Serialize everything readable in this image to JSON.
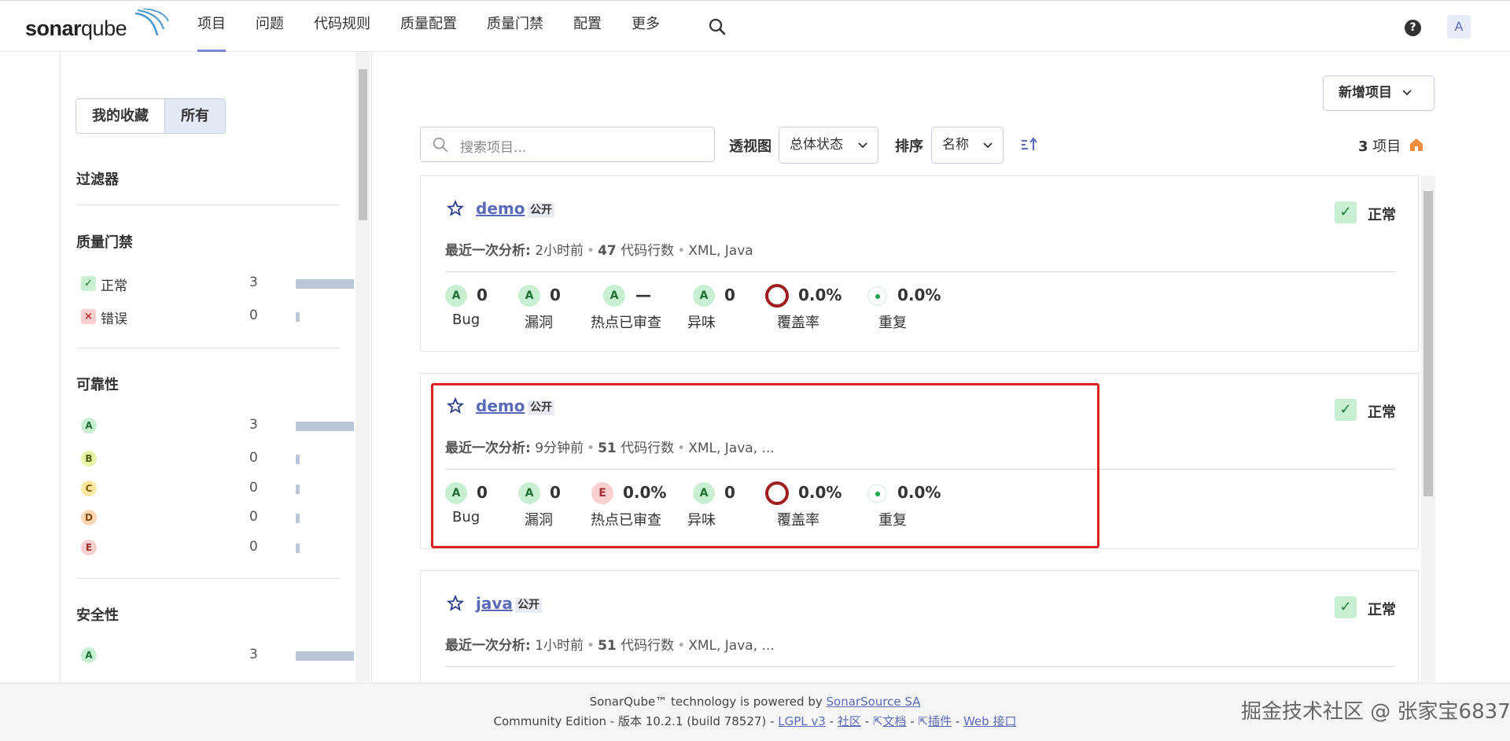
{
  "nav": {
    "logo_text": "sonarqube",
    "items": [
      {
        "label": "项目"
      },
      {
        "label": "问题"
      },
      {
        "label": "代码规则"
      },
      {
        "label": "质量配置"
      },
      {
        "label": "质量门禁"
      },
      {
        "label": "配置"
      },
      {
        "label": "更多"
      }
    ],
    "active_index": 0,
    "help_icon": "?",
    "avatar": "A"
  },
  "sidebar": {
    "toggle": {
      "favorites": "我的收藏",
      "all": "所有",
      "selected": "所有"
    },
    "filters_title": "过滤器",
    "quality_gate": {
      "title": "质量门禁",
      "items": [
        {
          "label": "正常",
          "count": "3",
          "fraction": 1.0,
          "icon": "check-icon"
        },
        {
          "label": "错误",
          "count": "0",
          "fraction": 0.0,
          "icon": "cross-icon"
        }
      ]
    },
    "reliability": {
      "title": "可靠性",
      "items": [
        {
          "rating": "A",
          "count": "3",
          "fraction": 1.0
        },
        {
          "rating": "B",
          "count": "0",
          "fraction": 0.0
        },
        {
          "rating": "C",
          "count": "0",
          "fraction": 0.0
        },
        {
          "rating": "D",
          "count": "0",
          "fraction": 0.0
        },
        {
          "rating": "E",
          "count": "0",
          "fraction": 0.0
        }
      ]
    },
    "security": {
      "title": "安全性",
      "items": [
        {
          "rating": "A",
          "count": "3",
          "fraction": 1.0
        }
      ]
    }
  },
  "toolbar": {
    "new_project": "新增项目",
    "search_placeholder": "搜索项目...",
    "perspective_label": "透视图",
    "perspective_value": "总体状态",
    "sort_label": "排序",
    "sort_value": "名称",
    "count": "3",
    "count_suffix": "项目"
  },
  "projects": [
    {
      "name": "demo",
      "visibility": "公开",
      "gate": "正常",
      "last_label": "最近一次分析:",
      "last_time": "2小时前",
      "loc": "47",
      "loc_label": "代码行数",
      "langs": "XML, Java",
      "metrics": {
        "bug": "0",
        "bug_r": "A",
        "vuln": "0",
        "vuln_r": "A",
        "hotspot": "—",
        "hotspot_r": "A",
        "smell": "0",
        "smell_r": "A",
        "coverage": "0.0%",
        "dup": "0.0%"
      }
    },
    {
      "name": "demo",
      "visibility": "公开",
      "gate": "正常",
      "last_label": "最近一次分析:",
      "last_time": "9分钟前",
      "loc": "51",
      "loc_label": "代码行数",
      "langs": "XML, Java, ...",
      "metrics": {
        "bug": "0",
        "bug_r": "A",
        "vuln": "0",
        "vuln_r": "A",
        "hotspot": "0.0%",
        "hotspot_r": "E",
        "smell": "0",
        "smell_r": "A",
        "coverage": "0.0%",
        "dup": "0.0%"
      }
    },
    {
      "name": "java",
      "visibility": "公开",
      "gate": "正常",
      "last_label": "最近一次分析:",
      "last_time": "1小时前",
      "loc": "51",
      "loc_label": "代码行数",
      "langs": "XML, Java, ..."
    }
  ],
  "metric_labels": {
    "bug": "Bug",
    "vuln": "漏洞",
    "hotspot": "热点已审查",
    "smell": "异味",
    "coverage": "覆盖率",
    "dup": "重复"
  },
  "footer": {
    "line1_prefix": "SonarQube™ technology is powered by",
    "line1_link": "SonarSource SA",
    "line2_prefix": "Community Edition - 版本 10.2.1 (build 78527) -",
    "lgpl": "LGPL v3",
    "community": "社区",
    "docs": "文档",
    "plugins": "插件",
    "web_api": "Web 接口",
    "sep": "-"
  },
  "brand_watermark": "掘金技术社区 @ 张家宝6837",
  "colors": {
    "accent": "#5b6ab8",
    "highlight": "#dd2222",
    "gate_ok": "#c9efd2"
  }
}
